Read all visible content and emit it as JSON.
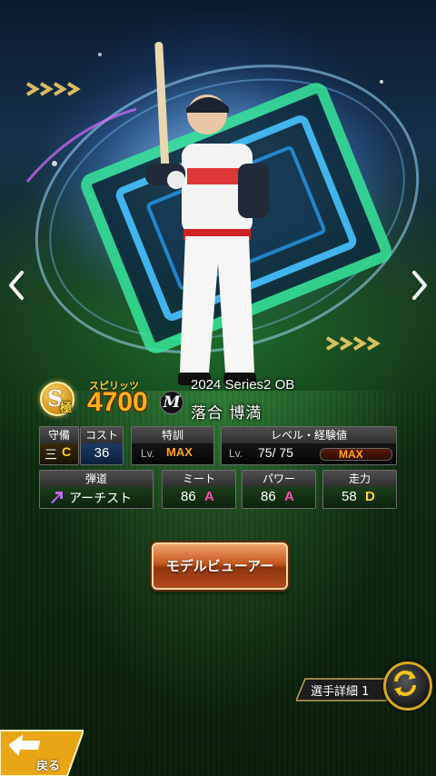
{
  "card": {
    "spirit_label": "スピリッツ",
    "spirit_value": "4700",
    "rank_letter": "S",
    "rank_suffix": "極",
    "team_logo_letter": "M",
    "series": "2024 Series2 OB",
    "player_name": "落合 博満"
  },
  "stats": {
    "position_header": "守備",
    "position_value": "三",
    "position_grade": "C",
    "cost_header": "コスト",
    "cost_value": "36",
    "training_header": "特訓",
    "training_lv_label": "Lv.",
    "training_value": "MAX",
    "level_header": "レベル・経験値",
    "level_lv_label": "Lv.",
    "level_value": "75/ 75",
    "exp_value": "MAX",
    "trajectory_header": "弾道",
    "trajectory_value": "アーチスト",
    "contact_header": "ミート",
    "contact_value": "86",
    "contact_grade": "A",
    "power_header": "パワー",
    "power_value": "86",
    "power_grade": "A",
    "speed_header": "走力",
    "speed_value": "58",
    "speed_grade": "D"
  },
  "buttons": {
    "model_viewer": "モデルビューアー",
    "player_detail": "選手詳細 1",
    "back": "戻る"
  },
  "colors": {
    "accent_orange": "#ffa41c",
    "grade_A": "#ff4fae",
    "grade_C": "#ffd22e",
    "grade_D": "#ffd22e",
    "trajectory_arrow": "#c76cff"
  },
  "icons": {
    "prev": "chevron-left-icon",
    "next": "chevron-right-icon",
    "switch": "rotate-arrows-icon",
    "back": "back-arrow-icon",
    "trajectory": "up-right-arrow-icon"
  }
}
